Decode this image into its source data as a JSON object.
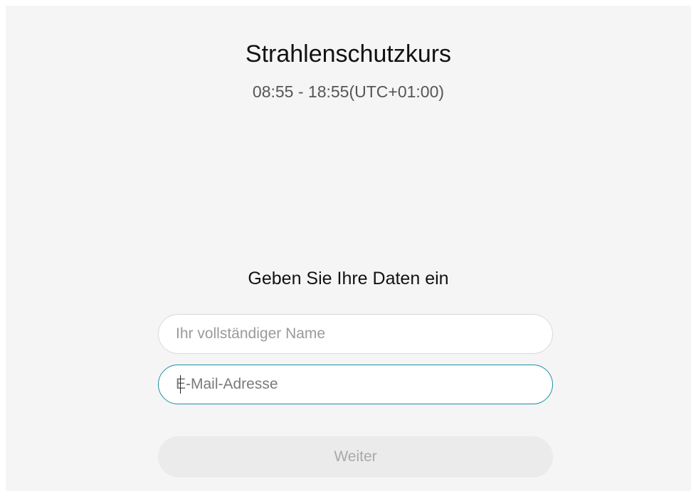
{
  "meeting": {
    "title": "Strahlenschutzkurs",
    "time": "08:55 - 18:55(UTC+01:00)"
  },
  "form": {
    "heading": "Geben Sie Ihre Daten ein",
    "name_placeholder": "Ihr vollständiger Name",
    "email_placeholder": "E-Mail-Adresse",
    "next_label": "Weiter"
  },
  "colors": {
    "background": "#f5f5f5",
    "focus_border": "#1f8fa6",
    "disabled_button": "#ebebeb"
  }
}
